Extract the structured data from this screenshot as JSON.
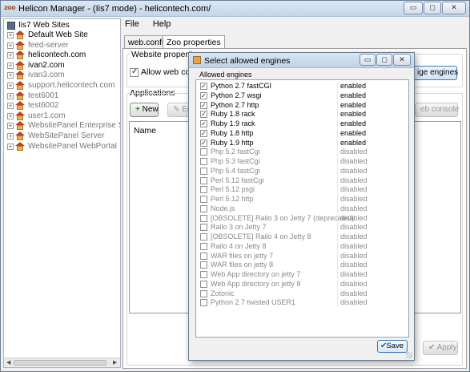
{
  "window": {
    "app_icon_text": "zoo",
    "title": "Helicon Manager - (Iis7 mode) - helicontech.com/",
    "min_glyph": "▭",
    "max_glyph": "◻",
    "close_glyph": "✕"
  },
  "tree": {
    "root": "Iis7 Web Sites",
    "items": [
      {
        "label": "Default Web Site",
        "enabled": true
      },
      {
        "label": "feed-server",
        "enabled": false
      },
      {
        "label": "helicontech.com",
        "enabled": true
      },
      {
        "label": "ivan2.com",
        "enabled": true
      },
      {
        "label": "ivan3.com",
        "enabled": false
      },
      {
        "label": "support.helicontech.com",
        "enabled": false
      },
      {
        "label": "test6001",
        "enabled": false
      },
      {
        "label": "test6002",
        "enabled": false
      },
      {
        "label": "user1.com",
        "enabled": false
      },
      {
        "label": "WebsitePanel Enterprise Serv",
        "enabled": false
      },
      {
        "label": "WebSitePanel Server",
        "enabled": false
      },
      {
        "label": "WebsitePanel WebPortal",
        "enabled": false
      }
    ]
  },
  "menu": {
    "file": "File",
    "help": "Help"
  },
  "tabs": {
    "webconfig": "web.config",
    "zoo": "Zoo properties"
  },
  "panel": {
    "website_properties": "Website properties",
    "allow_web_console": "Allow web conso",
    "manage_engines": "ige engines",
    "applications": "Applications",
    "new_button": "New",
    "edit_button": "Edi",
    "web_console_button": "eb console",
    "name_column": "Name",
    "apply_button": "Apply"
  },
  "dialog": {
    "title": "Select allowed engines",
    "group_label": "Allowed engines",
    "save_label": "Save",
    "engines": [
      {
        "name": "Python 2.7 fastCGI",
        "status": "enabled",
        "checked": true
      },
      {
        "name": "Python 2.7 wsgi",
        "status": "enabled",
        "checked": true
      },
      {
        "name": "Python 2.7 http",
        "status": "enabled",
        "checked": true
      },
      {
        "name": "Ruby 1.8 rack",
        "status": "enabled",
        "checked": true
      },
      {
        "name": "Ruby 1.9 rack",
        "status": "enabled",
        "checked": true
      },
      {
        "name": "Ruby 1.8 http",
        "status": "enabled",
        "checked": true
      },
      {
        "name": "Ruby 1.9 http",
        "status": "enabled",
        "checked": true
      },
      {
        "name": "Php 5.2 fastCgi",
        "status": "disabled",
        "checked": false
      },
      {
        "name": "Php 5.3 fastCgi",
        "status": "disabled",
        "checked": false
      },
      {
        "name": "Php 5.4 fastCgi",
        "status": "disabled",
        "checked": false
      },
      {
        "name": "Perl 5.12 fastCgi",
        "status": "disabled",
        "checked": false
      },
      {
        "name": "Perl 5.12 psgi",
        "status": "disabled",
        "checked": false
      },
      {
        "name": "Perl 5.12 http",
        "status": "disabled",
        "checked": false
      },
      {
        "name": "Node.js",
        "status": "disabled",
        "checked": false
      },
      {
        "name": "[OBSOLETE] Railo 3 on Jetty 7 (deprecated)",
        "status": "disabled",
        "checked": false
      },
      {
        "name": "Railo 3 on Jetty 7",
        "status": "disabled",
        "checked": false
      },
      {
        "name": "[OBSOLETE] Railo 4 on Jetty 8",
        "status": "disabled",
        "checked": false
      },
      {
        "name": "Railo 4 on Jetty 8",
        "status": "disabled",
        "checked": false
      },
      {
        "name": "WAR files on jetty 7",
        "status": "disabled",
        "checked": false
      },
      {
        "name": "WAR files on jetty 8",
        "status": "disabled",
        "checked": false
      },
      {
        "name": "Web App directory on jetty 7",
        "status": "disabled",
        "checked": false
      },
      {
        "name": "Web App directory on jetty 8",
        "status": "disabled",
        "checked": false
      },
      {
        "name": "Zotonic",
        "status": "disabled",
        "checked": false
      },
      {
        "name": "Python 2.7 twisted USER1",
        "status": "disabled",
        "checked": false
      }
    ]
  }
}
